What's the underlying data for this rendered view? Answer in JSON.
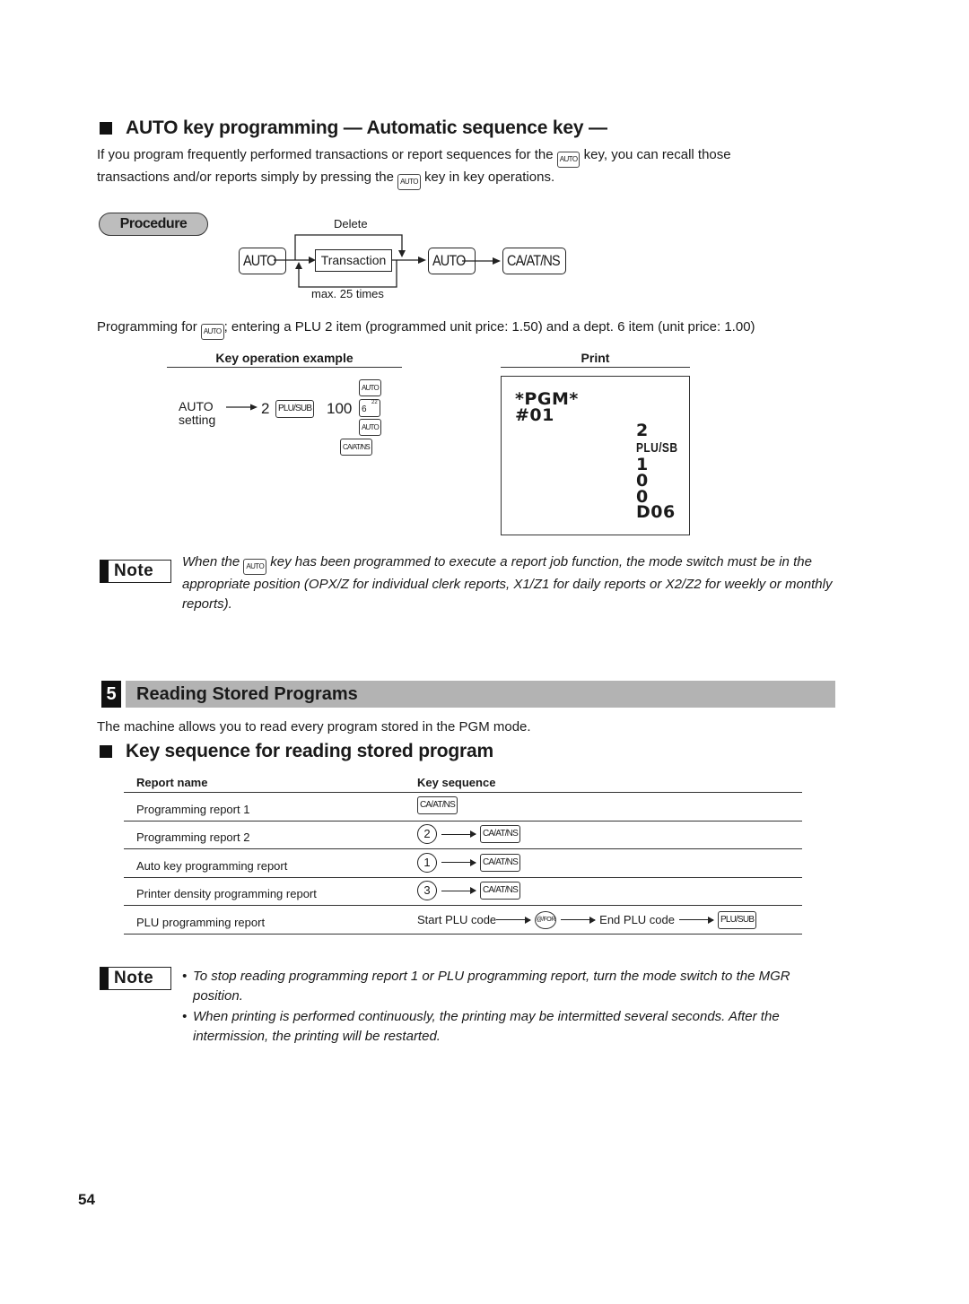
{
  "auto_section": {
    "heading": "AUTO key programming — Automatic sequence key —",
    "intro_part1": "If you program frequently performed transactions or report sequences for the",
    "intro_part2": "key, you can recall those",
    "intro_part3": "transactions and/or reports simply by pressing the",
    "intro_part4": "key in key operations.",
    "auto_key_glyph": "AUTO"
  },
  "procedure": {
    "label": "Procedure",
    "delete_label": "Delete",
    "start_key": "AUTO",
    "transaction_label": "Transaction",
    "repeat_label": "max. 25 times",
    "end_key": "AUTO",
    "final_key": "CA/AT/NS"
  },
  "example": {
    "description_part1": "Programming for",
    "description_part2": "; entering a PLU 2 item (programmed unit price: 1.50) and a dept. 6 item (unit price: 1.00)",
    "key_op_heading": "Key operation example",
    "print_heading": "Print",
    "mode_label_line1": "AUTO",
    "mode_label_line2": "setting",
    "entry_number": "2",
    "plu_key": "PLU/SUB",
    "price_entry": "100",
    "dept_key_main": "6",
    "dept_key_sup": "22",
    "auto_key_top": "AUTO",
    "auto_key_bottom": "AUTO",
    "caatns_key": "CA/AT/NS"
  },
  "receipt": {
    "lines_left": [
      "*PGM*",
      "#01"
    ],
    "lines_right": [
      "2",
      "PLU/SB",
      "1",
      "0",
      "0",
      "D06"
    ]
  },
  "note1": {
    "badge": "Note",
    "text_part1": "When the",
    "text_part2": "key has been programmed to execute a report job function, the mode switch must be in the appropriate position (OPX/Z for individual clerk reports, X1/Z1 for daily reports or X2/Z2 for weekly or monthly reports)."
  },
  "section5": {
    "number": "5",
    "title": "Reading Stored Programs",
    "intro": "The machine allows you to read every program stored in the PGM mode.",
    "subheading": "Key sequence for reading stored program"
  },
  "report_table": {
    "headers": [
      "Report name",
      "Key sequence"
    ],
    "rows": [
      {
        "name": "Programming report 1",
        "prefix": "",
        "key": "CA/AT/NS"
      },
      {
        "name": "Programming report 2",
        "prefix": "2",
        "key": "CA/AT/NS"
      },
      {
        "name": "Auto key programming report",
        "prefix": "1",
        "key": "CA/AT/NS"
      },
      {
        "name": "Printer density programming report",
        "prefix": "3",
        "key": "CA/AT/NS"
      },
      {
        "name": "PLU programming report",
        "start_label": "Start PLU code",
        "mid_key": "@/FOR",
        "end_label": "End PLU code",
        "key": "PLU/SUB"
      }
    ]
  },
  "note2": {
    "badge": "Note",
    "bullets": [
      "To stop reading programming report 1 or PLU programming report, turn the mode switch to the MGR position.",
      "When printing is performed continuously, the printing may be intermitted several seconds.  After the intermission, the printing will be restarted."
    ]
  },
  "page_number": "54"
}
